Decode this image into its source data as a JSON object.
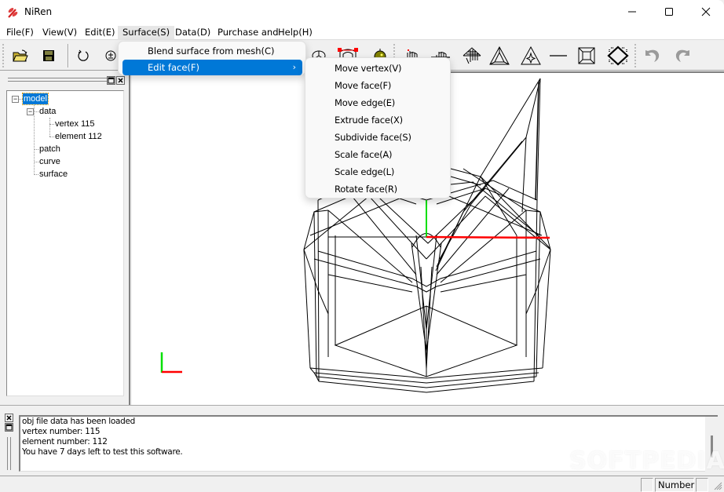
{
  "window": {
    "title": "NiRen",
    "controls": {
      "minimize": "minimize",
      "maximize": "maximize",
      "close": "close"
    }
  },
  "menubar": {
    "items": [
      {
        "label": "File(F)"
      },
      {
        "label": "View(V)"
      },
      {
        "label": "Edit(E)"
      },
      {
        "label": "Surface(S)",
        "active": true
      },
      {
        "label": "Data(D)"
      },
      {
        "label": "Purchase and"
      },
      {
        "label": "Help(H)"
      }
    ]
  },
  "toolbar": {
    "buttons": [
      {
        "icon": "open-folder-icon",
        "tooltip": "Open"
      },
      {
        "icon": "save-disk-icon",
        "tooltip": "Save"
      },
      {
        "icon": "rotate-icon",
        "tooltip": "Rotate"
      },
      {
        "icon": "zoom-plus-minus-icon",
        "tooltip": "Zoom"
      },
      {
        "icon": "sphere-wire-icon"
      },
      {
        "icon": "control-points-icon"
      },
      {
        "icon": "ball-icon"
      },
      {
        "icon": "select-vertex-hand-icon"
      },
      {
        "icon": "select-edge-hand-icon"
      },
      {
        "icon": "select-face-hand-icon"
      },
      {
        "icon": "triangle-inset-icon"
      },
      {
        "icon": "triangle-star-icon"
      },
      {
        "icon": "line-icon"
      },
      {
        "icon": "square-inset-icon"
      },
      {
        "icon": "diamond-icon"
      },
      {
        "icon": "undo-icon",
        "disabled": true
      },
      {
        "icon": "redo-icon",
        "disabled": true
      }
    ]
  },
  "tree": {
    "nodes": [
      {
        "label": "model",
        "selected": true,
        "expanded": true
      },
      {
        "label": "data",
        "expanded": true
      },
      {
        "label": "vertex 115"
      },
      {
        "label": "element 112"
      },
      {
        "label": "patch"
      },
      {
        "label": "curve"
      },
      {
        "label": "surface"
      }
    ]
  },
  "surface_menu": {
    "items": [
      {
        "label": "Blend surface from mesh(C)"
      },
      {
        "label": "Edit face(F)",
        "highlighted": true,
        "submenu_arrow": "›"
      }
    ]
  },
  "edit_face_submenu": {
    "items": [
      {
        "label": "Move vertex(V)"
      },
      {
        "label": "Move face(F)"
      },
      {
        "label": "Move edge(E)"
      },
      {
        "label": "Extrude face(X)"
      },
      {
        "label": "Subdivide face(S)"
      },
      {
        "label": "Scale face(A)"
      },
      {
        "label": "Scale edge(L)"
      },
      {
        "label": "Rotate face(R)"
      }
    ]
  },
  "viewport": {
    "axis_colors": {
      "x": "#ff0000",
      "y": "#00e000"
    },
    "wire_color": "#000000"
  },
  "log": {
    "lines": [
      "obj file data has been loaded",
      "vertex number: 115",
      "element number: 112",
      "You have 7 days left to test this software."
    ]
  },
  "statusbar": {
    "panes": [
      "",
      "Number",
      ""
    ]
  },
  "watermark": "SOFTPEDIA",
  "colors": {
    "accent": "#0078d7",
    "selection_text": "#ffffff"
  }
}
